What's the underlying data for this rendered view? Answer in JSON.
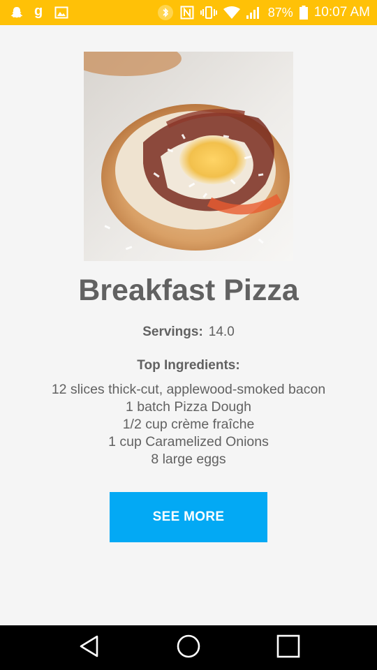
{
  "status_bar": {
    "battery_percent": "87%",
    "time": "10:07 AM",
    "left_icons": [
      "snapchat-icon",
      "goodreads-icon",
      "gallery-icon"
    ],
    "right_icons": [
      "bluetooth-icon",
      "nfc-icon",
      "vibrate-icon",
      "wifi-icon",
      "signal-icon",
      "battery-icon"
    ],
    "background_color": "#ffc107"
  },
  "recipe": {
    "image_alt": "breakfast-pizza-photo",
    "title": "Breakfast Pizza",
    "servings_label": "Servings:",
    "servings_value": "14.0",
    "ingredients_heading": "Top Ingredients:",
    "ingredients": [
      "12 slices thick-cut, applewood-smoked bacon",
      "1 batch Pizza Dough",
      "1/2 cup crème fraîche",
      "1 cup Caramelized Onions",
      "8 large eggs"
    ]
  },
  "actions": {
    "see_more_label": "SEE MORE",
    "button_color": "#03a9f4"
  },
  "nav_bar": {
    "icons": [
      "back-icon",
      "home-icon",
      "recents-icon"
    ]
  }
}
